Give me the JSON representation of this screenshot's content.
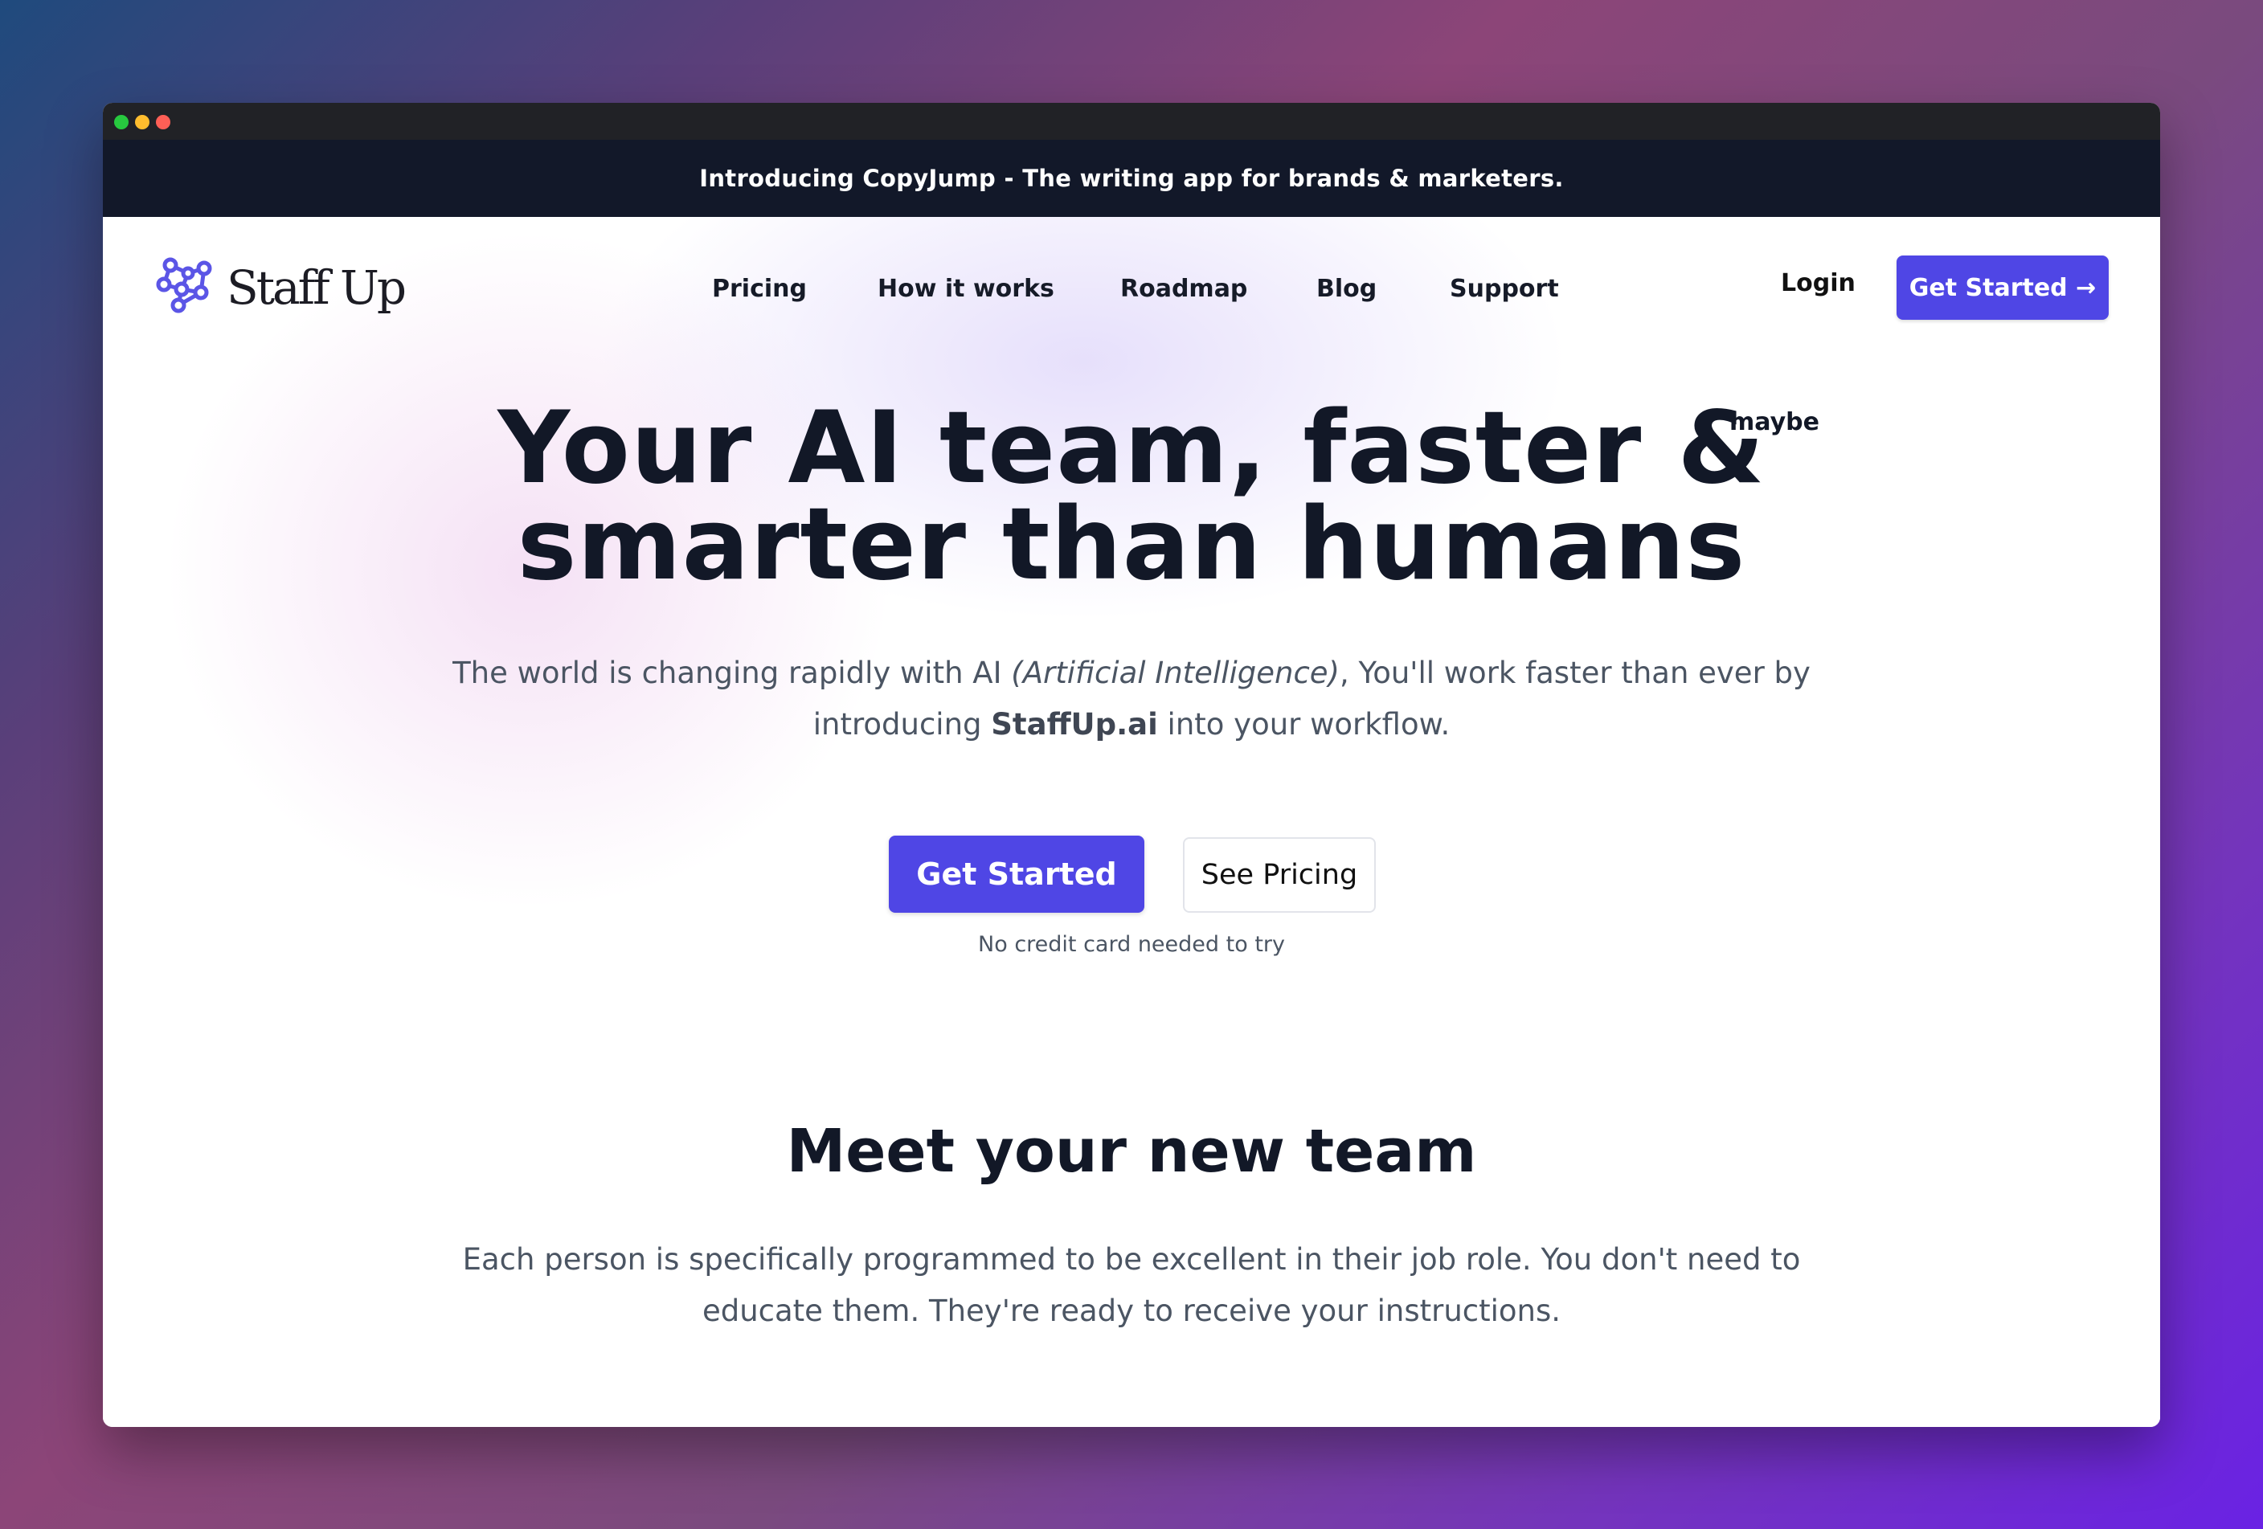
{
  "announcement": {
    "text": "Introducing CopyJump - The writing app for brands & marketers."
  },
  "brand": {
    "name": "Staff Up",
    "icon": "network-molecule-icon",
    "accent_color": "#4f46e5"
  },
  "nav": {
    "links": [
      "Pricing",
      "How it works",
      "Roadmap",
      "Blog",
      "Support"
    ],
    "login": "Login",
    "cta": "Get Started →"
  },
  "hero": {
    "title_line1": "Your AI team, faster &",
    "title_line2": "smarter than humans",
    "maybe": "maybe",
    "sub_part1": "The world is changing rapidly with AI ",
    "sub_em": "(Artificial Intelligence)",
    "sub_part2": ", You'll work faster than ever by introducing ",
    "sub_strong": "StaffUp.ai",
    "sub_part3": " into your workflow.",
    "primary_button": "Get Started",
    "secondary_button": "See Pricing",
    "note": "No credit card needed to try"
  },
  "team_section": {
    "title": "Meet your new team",
    "description": "Each person is specifically programmed to be excellent in their job role. You don't need to educate them. They're ready to receive your instructions."
  }
}
